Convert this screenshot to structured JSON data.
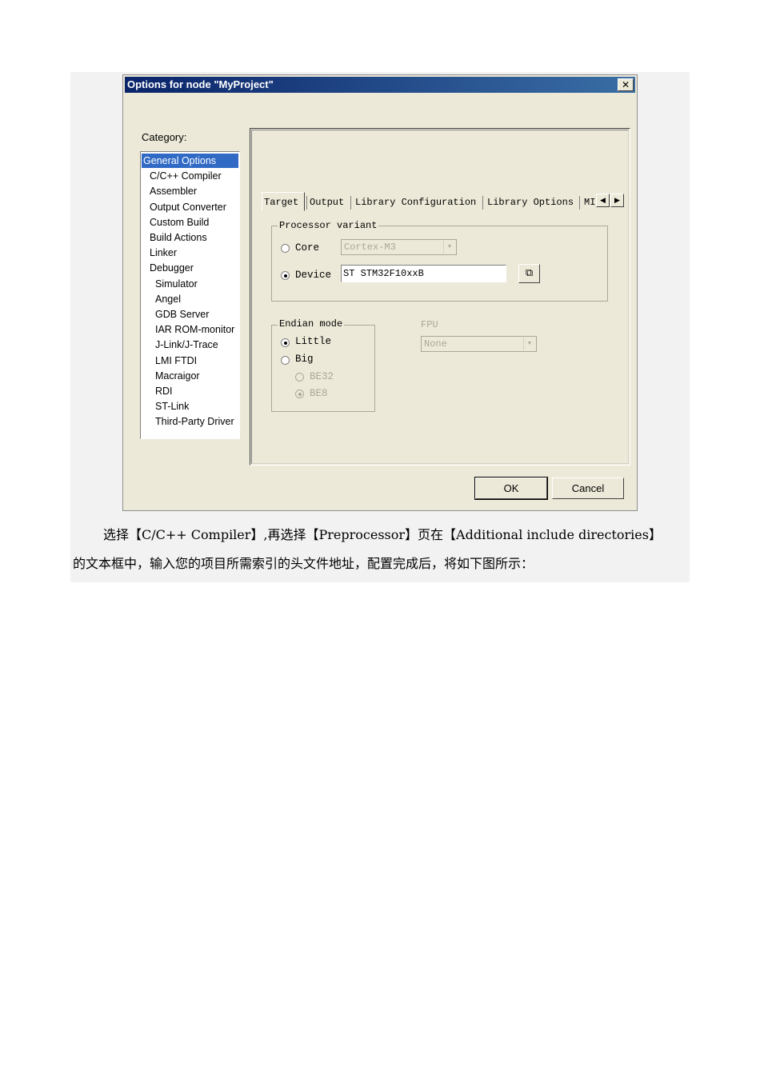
{
  "dialog": {
    "title": "Options for node \"MyProject\"",
    "close_glyph": "✕",
    "category_label": "Category:",
    "categories": [
      {
        "label": "General Options",
        "selected": true,
        "indent": 0
      },
      {
        "label": "C/C++ Compiler",
        "indent": 1
      },
      {
        "label": "Assembler",
        "indent": 1
      },
      {
        "label": "Output Converter",
        "indent": 1
      },
      {
        "label": "Custom Build",
        "indent": 1
      },
      {
        "label": "Build Actions",
        "indent": 1
      },
      {
        "label": "Linker",
        "indent": 1
      },
      {
        "label": "Debugger",
        "indent": 1
      },
      {
        "label": "Simulator",
        "indent": 2
      },
      {
        "label": "Angel",
        "indent": 2
      },
      {
        "label": "GDB Server",
        "indent": 2
      },
      {
        "label": "IAR ROM-monitor",
        "indent": 2
      },
      {
        "label": "J-Link/J-Trace",
        "indent": 2
      },
      {
        "label": "LMI FTDI",
        "indent": 2
      },
      {
        "label": "Macraigor",
        "indent": 2
      },
      {
        "label": "RDI",
        "indent": 2
      },
      {
        "label": "ST-Link",
        "indent": 2
      },
      {
        "label": "Third-Party Driver",
        "indent": 2
      }
    ],
    "tabs": [
      "Target",
      "Output",
      "Library Configuration",
      "Library Options",
      "MI"
    ],
    "active_tab": "Target",
    "processor_variant": {
      "title": "Processor variant",
      "core_label": "Core",
      "core_value": "Cortex-M3",
      "device_label": "Device",
      "device_value": "ST STM32F10xxB",
      "selected": "Device"
    },
    "endian_mode": {
      "title": "Endian mode",
      "little_label": "Little",
      "big_label": "Big",
      "be32_label": "BE32",
      "be8_label": "BE8",
      "selected": "Little"
    },
    "fpu": {
      "label": "FPU",
      "value": "None"
    },
    "ok_label": "OK",
    "cancel_label": "Cancel"
  },
  "caption": {
    "line1": "选择【C/C++ Compiler】,再选择【Preprocessor】页在【Additional include directories】",
    "line2": "的文本框中，输入您的项目所需索引的头文件地址，配置完成后，将如下图所示："
  },
  "icons": {
    "scroll_left": "◀",
    "scroll_right": "▶",
    "dropdown": "▼",
    "browse": "⧉"
  }
}
